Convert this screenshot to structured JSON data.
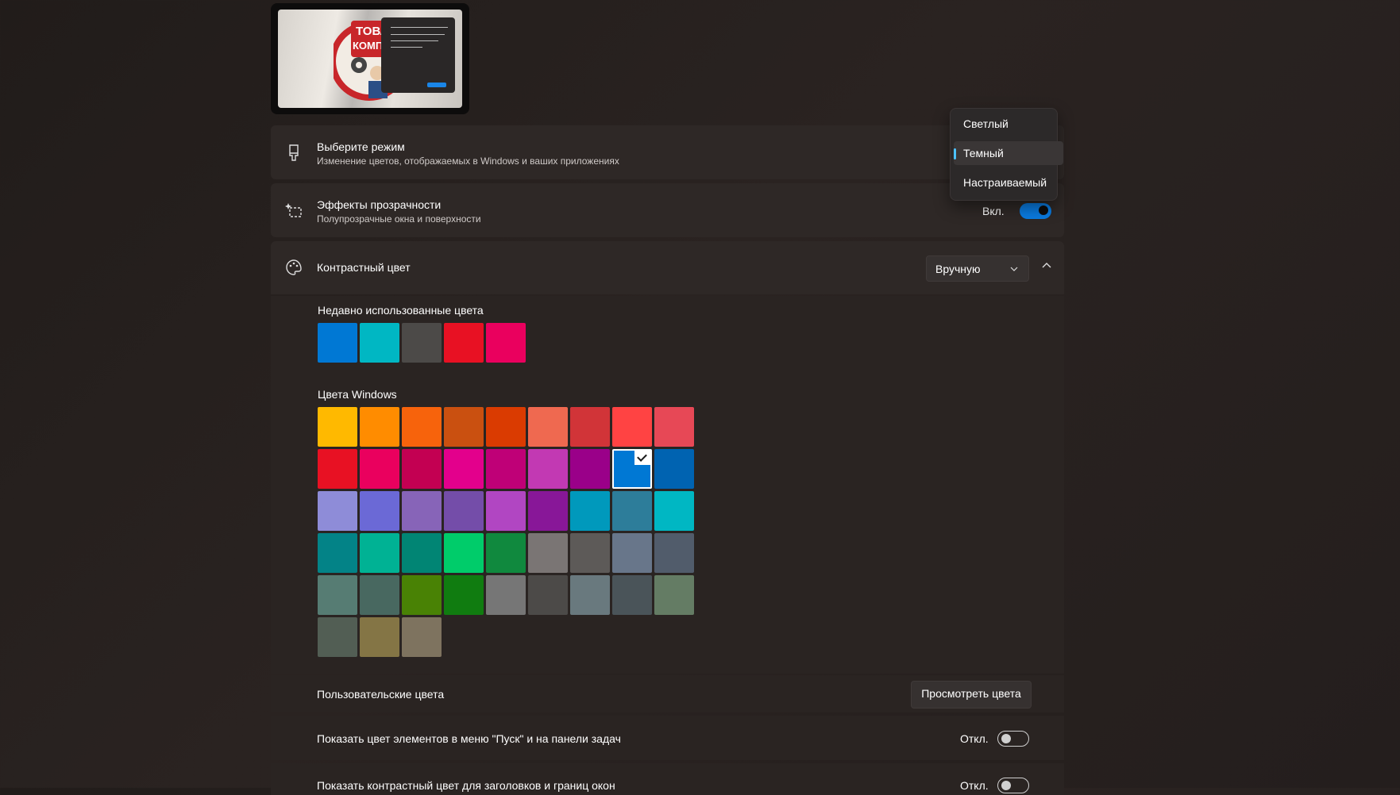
{
  "mode": {
    "title": "Выберите режим",
    "subtitle": "Изменение цветов, отображаемых в Windows и ваших приложениях",
    "options": [
      "Светлый",
      "Темный",
      "Настраиваемый"
    ],
    "selected": "Темный"
  },
  "transparency": {
    "title": "Эффекты прозрачности",
    "subtitle": "Полупрозрачные окна и поверхности",
    "state_label": "Вкл.",
    "on": true
  },
  "accent": {
    "title": "Контрастный цвет",
    "select_value": "Вручную",
    "recent_label": "Недавно использованные цвета",
    "recent_colors": [
      "#0078d4",
      "#00b7c3",
      "#4c4a48",
      "#e81123",
      "#ea005e"
    ],
    "windows_label": "Цвета Windows",
    "selected_color": "#0078d4",
    "windows_colors": [
      [
        "#ffb900",
        "#ff8c00",
        "#f7630c",
        "#ca5010",
        "#da3b01",
        "#ef6950",
        "#d13438",
        "#ff4343",
        "#e74856"
      ],
      [
        "#e81123",
        "#ea005e",
        "#c30052",
        "#e3008c",
        "#bf0077",
        "#c239b3",
        "#9a0089",
        "#0078d4",
        "#0063b1"
      ],
      [
        "#8e8cd8",
        "#6b69d6",
        "#8764b8",
        "#744da9",
        "#b146c2",
        "#881798",
        "#0099bc",
        "#2d7d9a",
        "#00b7c3"
      ],
      [
        "#038387",
        "#00b294",
        "#018574",
        "#00cc6a",
        "#10893e",
        "#7a7574",
        "#5d5a58",
        "#68768a",
        "#515c6b"
      ],
      [
        "#567c73",
        "#486860",
        "#498205",
        "#107c10",
        "#767676",
        "#4c4a48",
        "#69797e",
        "#4a5459",
        "#647c64"
      ],
      [
        "#525e54",
        "#847545",
        "#7e735f"
      ]
    ]
  },
  "custom_colors": {
    "label": "Пользовательские цвета",
    "button": "Просмотреть цвета"
  },
  "start_taskbar": {
    "label": "Показать цвет элементов в меню \"Пуск\" и на панели задач",
    "state_label": "Откл.",
    "on": false
  },
  "title_bars": {
    "label": "Показать контрастный цвет для заголовков и границ окон",
    "state_label": "Откл.",
    "on": false
  },
  "preview": {
    "wallpaper_text_1": "ТОВАР",
    "wallpaper_text_2": "КОМПЬК"
  }
}
